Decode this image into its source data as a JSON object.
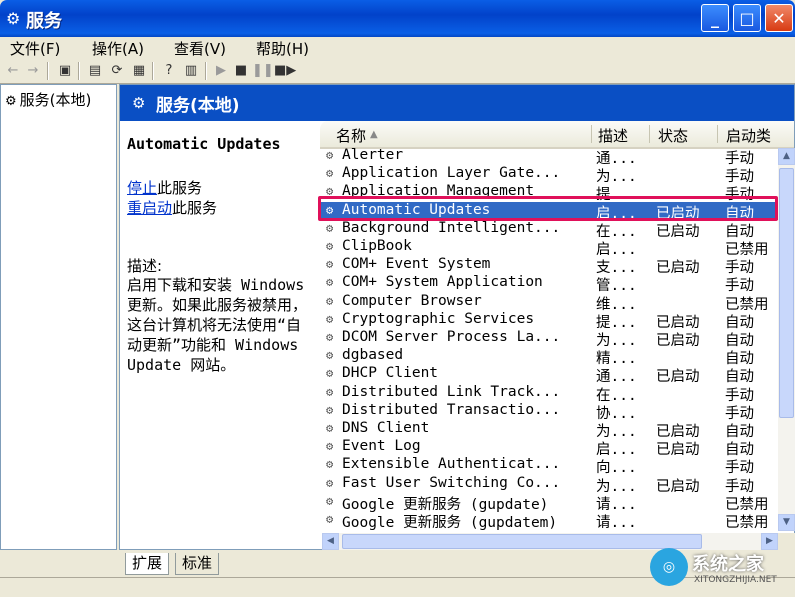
{
  "window": {
    "title": "服务",
    "min": "_",
    "max": "□",
    "close": "✕"
  },
  "menu": [
    "文件(F)",
    "操作(A)",
    "查看(V)",
    "帮助(H)"
  ],
  "tree": {
    "root": "服务(本地)"
  },
  "banner": {
    "title": "服务(本地)"
  },
  "details": {
    "service_name": "Automatic Updates",
    "stop_link": "停止",
    "stop_suffix": "此服务",
    "restart_link": "重启动",
    "restart_suffix": "此服务",
    "desc_label": "描述:",
    "desc_text": "启用下载和安装 Windows 更新。如果此服务被禁用，这台计算机将无法使用“自动更新”功能和 Windows Update 网站。"
  },
  "columns": [
    "名称",
    "描述",
    "状态",
    "启动类"
  ],
  "rows": [
    {
      "name": "Alerter",
      "desc": "通...",
      "status": "",
      "startup": "手动"
    },
    {
      "name": "Application Layer Gate...",
      "desc": "为...",
      "status": "",
      "startup": "手动"
    },
    {
      "name": "Application Management",
      "desc": "提...",
      "status": "",
      "startup": "手动"
    },
    {
      "name": "Automatic Updates",
      "desc": "启...",
      "status": "已启动",
      "startup": "自动",
      "selected": true
    },
    {
      "name": "Background Intelligent...",
      "desc": "在...",
      "status": "已启动",
      "startup": "自动"
    },
    {
      "name": "ClipBook",
      "desc": "启...",
      "status": "",
      "startup": "已禁用"
    },
    {
      "name": "COM+ Event System",
      "desc": "支...",
      "status": "已启动",
      "startup": "手动"
    },
    {
      "name": "COM+ System Application",
      "desc": "管...",
      "status": "",
      "startup": "手动"
    },
    {
      "name": "Computer Browser",
      "desc": "维...",
      "status": "",
      "startup": "已禁用"
    },
    {
      "name": "Cryptographic Services",
      "desc": "提...",
      "status": "已启动",
      "startup": "自动"
    },
    {
      "name": "DCOM Server Process La...",
      "desc": "为...",
      "status": "已启动",
      "startup": "自动"
    },
    {
      "name": "dgbased",
      "desc": "精...",
      "status": "",
      "startup": "自动"
    },
    {
      "name": "DHCP Client",
      "desc": "通...",
      "status": "已启动",
      "startup": "自动"
    },
    {
      "name": "Distributed Link Track...",
      "desc": "在...",
      "status": "",
      "startup": "手动"
    },
    {
      "name": "Distributed Transactio...",
      "desc": "协...",
      "status": "",
      "startup": "手动"
    },
    {
      "name": "DNS Client",
      "desc": "为...",
      "status": "已启动",
      "startup": "自动"
    },
    {
      "name": "Event Log",
      "desc": "启...",
      "status": "已启动",
      "startup": "自动"
    },
    {
      "name": "Extensible Authenticat...",
      "desc": "向...",
      "status": "",
      "startup": "手动"
    },
    {
      "name": "Fast User Switching Co...",
      "desc": "为...",
      "status": "已启动",
      "startup": "手动"
    },
    {
      "name": "Google 更新服务 (gupdate)",
      "desc": "请...",
      "status": "",
      "startup": "已禁用"
    },
    {
      "name": "Google 更新服务 (gupdatem)",
      "desc": "请...",
      "status": "",
      "startup": "已禁用"
    }
  ],
  "tabs": [
    "扩展",
    "标准"
  ],
  "watermark": {
    "name": "系统之家",
    "url": "XITONGZHIJIA.NET"
  }
}
